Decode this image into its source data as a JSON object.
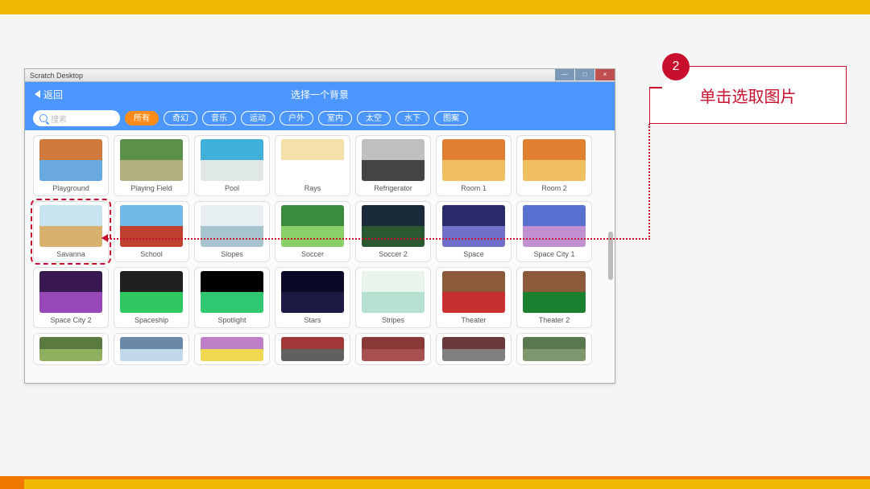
{
  "window": {
    "title": "Scratch Desktop",
    "min": "—",
    "max": "□",
    "close": "×"
  },
  "header": {
    "back_label": "返回",
    "title": "选择一个背景"
  },
  "search": {
    "placeholder": "搜索"
  },
  "filters": {
    "all": "所有",
    "f1": "奇幻",
    "f2": "音乐",
    "f3": "运动",
    "f4": "户外",
    "f5": "室内",
    "f6": "太空",
    "f7": "水下",
    "f8": "图案"
  },
  "cells": {
    "r0": [
      "Playground",
      "Playing Field",
      "Pool",
      "Rays",
      "Refrigerator",
      "Room 1",
      "Room 2"
    ],
    "r1": [
      "Savanna",
      "School",
      "Slopes",
      "Soccer",
      "Soccer 2",
      "Space",
      "Space City 1"
    ],
    "r2": [
      "Space City 2",
      "Spaceship",
      "Spotlight",
      "Stars",
      "Stripes",
      "Theater",
      "Theater 2"
    ]
  },
  "step": {
    "num": "2",
    "text": "单击选取图片"
  },
  "thumb_colors": {
    "r0": [
      "#d07a40,#6aa8e0",
      "#5a9048,#b0b080",
      "#40b0d8,#e0e8e8",
      "#f4e0a8,#fff",
      "#c0c0c0,#444",
      "#e08030,#f0c060",
      "#e08030,#f0c060"
    ],
    "r1": [
      "#c8e4f0,#d8b070",
      "#70b8e8,#c04030",
      "#e8f0f4,#a8c4d0",
      "#3a8a40,#8ad068",
      "#1a2a3a,#2a5830",
      "#2a2a6a,#7070c8",
      "#5870d0,#c090d0"
    ],
    "r2": [
      "#3a1850,#9848b8",
      "#202020,#30c860",
      "#000000,#30c870",
      "#0a0a28,#1a1a44",
      "#e8f4ec,#b8e0d0",
      "#8a5a3a,#c83030",
      "#8a5a3a,#1a8030"
    ],
    "r3": [
      "#5a7a40,#90b060",
      "#6a88a8,#c0d8e8",
      "#c080c8,#f0d850",
      "#a03838,#606060",
      "#8a3838,#a85050",
      "#6a3a3a,#808080",
      "#5a7850,#809870"
    ]
  }
}
